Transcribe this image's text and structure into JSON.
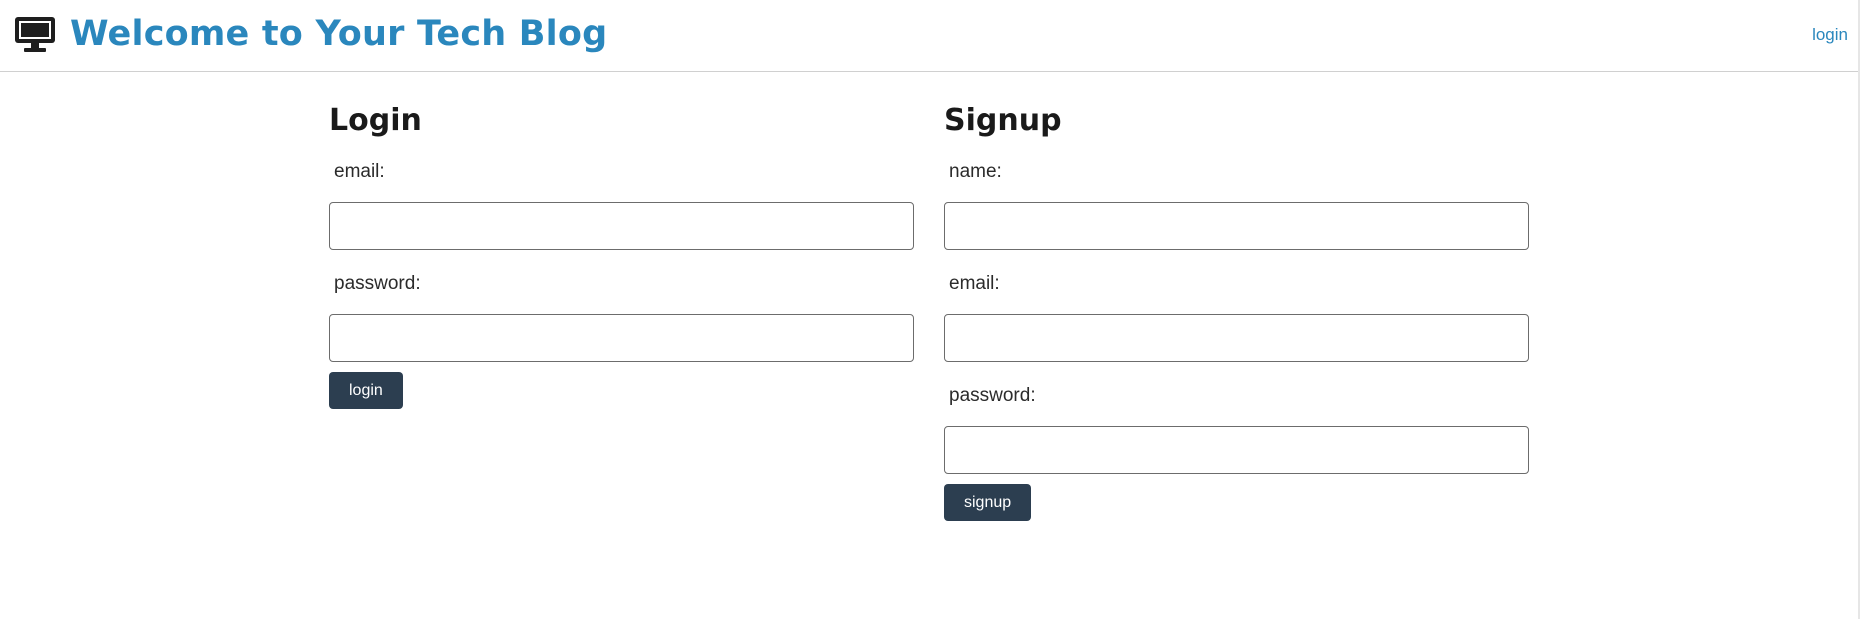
{
  "header": {
    "title": "Welcome to Your Tech Blog",
    "nav_login": "login",
    "icon": "monitor-icon",
    "accent_color": "#2a87bd"
  },
  "login": {
    "heading": "Login",
    "email_label": "email:",
    "email_value": "",
    "password_label": "password:",
    "password_value": "",
    "button_label": "login"
  },
  "signup": {
    "heading": "Signup",
    "name_label": "name:",
    "name_value": "",
    "email_label": "email:",
    "email_value": "",
    "password_label": "password:",
    "password_value": "",
    "button_label": "signup"
  },
  "button_color": "#2c3e50"
}
